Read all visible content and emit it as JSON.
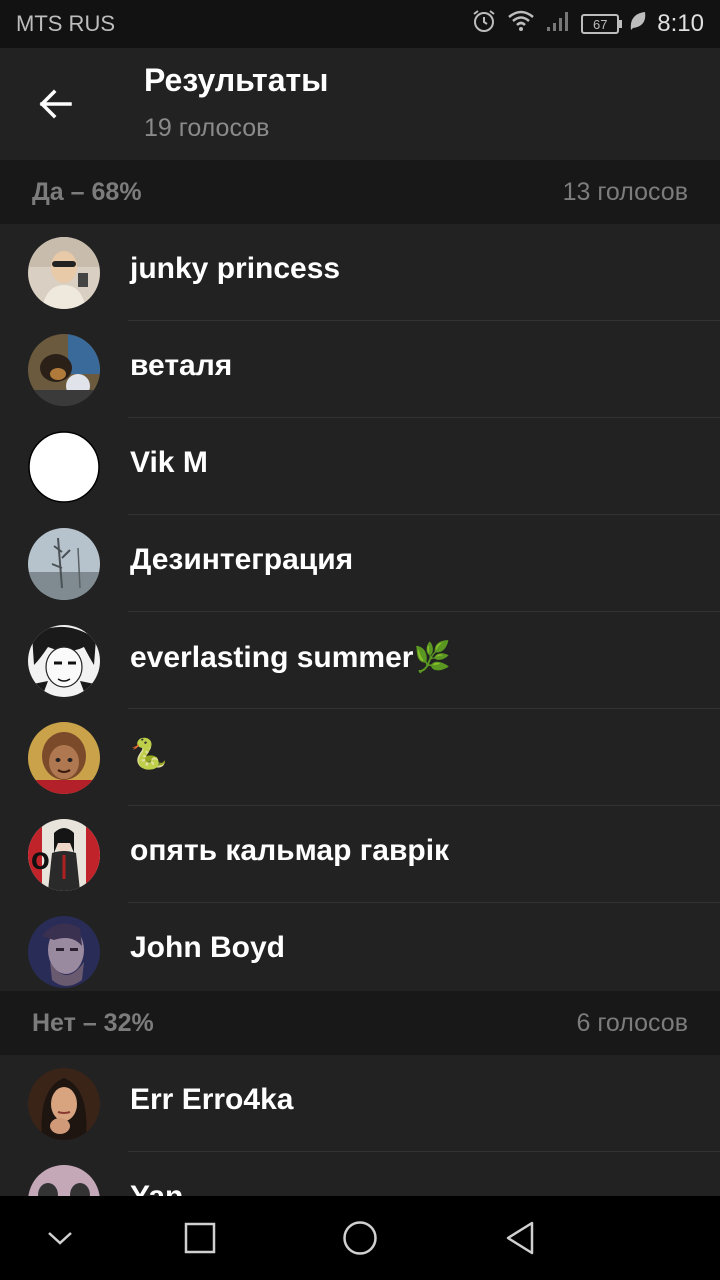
{
  "status_bar": {
    "carrier": "MTS RUS",
    "battery": "67",
    "time": "8:10",
    "icons": [
      "alarm-icon",
      "wifi-icon",
      "signal-icon",
      "battery-icon",
      "leaf-icon"
    ]
  },
  "header": {
    "title": "Результаты",
    "subtitle": "19 голосов"
  },
  "options": [
    {
      "label": "Да – 68%",
      "votes": "13 голосов",
      "voters": [
        {
          "name": "junky princess"
        },
        {
          "name": "веталя"
        },
        {
          "name": "Vik M"
        },
        {
          "name": "Дезинтеграция"
        },
        {
          "name": "everlasting summer🌿"
        },
        {
          "name": "🐍"
        },
        {
          "name": "опять кальмар гаврік"
        },
        {
          "name": "John Boyd"
        }
      ]
    },
    {
      "label": "Нет – 32%",
      "votes": "6 голосов",
      "voters": [
        {
          "name": "Err Erro4ka"
        },
        {
          "name": "Yan"
        }
      ]
    }
  ],
  "colors": {
    "background": "#222222",
    "section_background": "#181818",
    "status_bar": "#121212",
    "nav_bar": "#000000"
  }
}
